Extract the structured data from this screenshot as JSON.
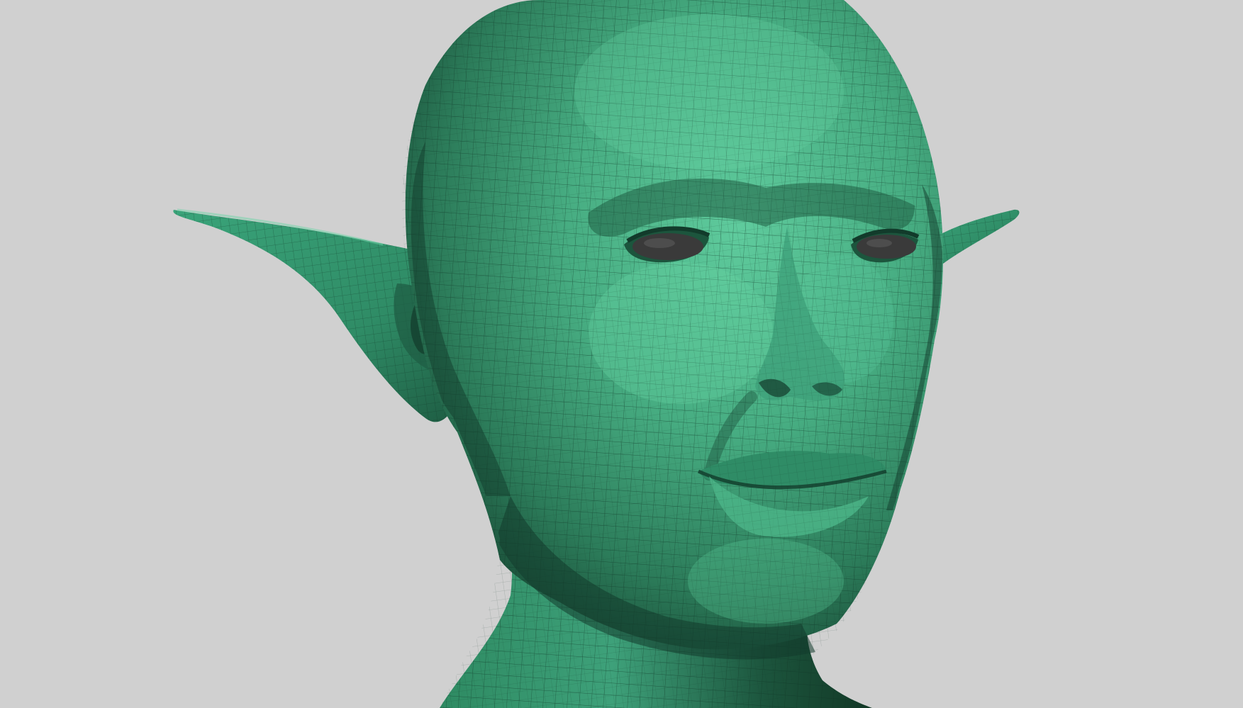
{
  "scene": {
    "subject": "sculpted-head-model",
    "colors": {
      "background": "#d0d0d0",
      "skin_light": "#5cc79a",
      "skin_mid": "#3f9f76",
      "skin_dark": "#1f5e44",
      "skin_deep": "#123b2b",
      "eye": "#3a3a3a",
      "wire": "#0f3324"
    }
  }
}
